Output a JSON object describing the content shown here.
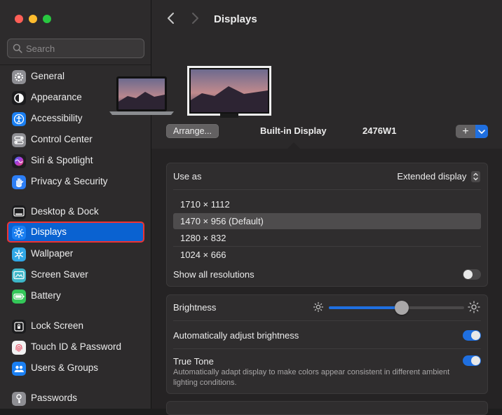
{
  "sidebar": {
    "search_placeholder": "Search",
    "items": [
      {
        "label": "General",
        "icon": "gear-icon",
        "color": "#8e8e93"
      },
      {
        "label": "Appearance",
        "icon": "appearance-icon",
        "color": "#1c1c1e"
      },
      {
        "label": "Accessibility",
        "icon": "accessibility-icon",
        "color": "#1a7ff2"
      },
      {
        "label": "Control Center",
        "icon": "control-center-icon",
        "color": "#8e8e93"
      },
      {
        "label": "Siri & Spotlight",
        "icon": "siri-icon",
        "color": "#9b3ed6"
      },
      {
        "label": "Privacy & Security",
        "icon": "hand-icon",
        "color": "#2c7ef5"
      },
      {
        "label": "Desktop & Dock",
        "icon": "dock-icon",
        "color": "#1c1c1e"
      },
      {
        "label": "Displays",
        "icon": "sun-icon",
        "color": "#1a7ff2"
      },
      {
        "label": "Wallpaper",
        "icon": "wallpaper-icon",
        "color": "#31a8e6"
      },
      {
        "label": "Screen Saver",
        "icon": "screen-saver-icon",
        "color": "#3db6c8"
      },
      {
        "label": "Battery",
        "icon": "battery-icon",
        "color": "#34c759"
      },
      {
        "label": "Lock Screen",
        "icon": "lock-icon",
        "color": "#1c1c1e"
      },
      {
        "label": "Touch ID & Password",
        "icon": "fingerprint-icon",
        "color": "#f2f2f2"
      },
      {
        "label": "Users & Groups",
        "icon": "users-icon",
        "color": "#1a7ff2"
      },
      {
        "label": "Passwords",
        "icon": "key-icon",
        "color": "#8e8e93"
      }
    ]
  },
  "header": {
    "title": "Displays"
  },
  "arrangement": {
    "arrange_label": "Arrange...",
    "plus_label": "+",
    "builtin_label": "Built-in Display",
    "external_label": "2476W1"
  },
  "use_as": {
    "label": "Use as",
    "value": "Extended display",
    "resolutions": [
      "1710 × 1112",
      "1470 × 956 (Default)",
      "1280 × 832",
      "1024 × 666"
    ],
    "selected_resolution": "1470 × 956 (Default)",
    "show_all_label": "Show all resolutions",
    "show_all_on": false
  },
  "brightness": {
    "label": "Brightness",
    "level": 0.54,
    "auto_label": "Automatically adjust brightness",
    "auto_on": true,
    "true_tone_label": "True Tone",
    "true_tone_desc": "Automatically adapt display to make colors appear consistent in different ambient lighting conditions.",
    "true_tone_on": true
  },
  "colors": {
    "accent": "#1f6fe0",
    "selection": "#0a62d1"
  }
}
